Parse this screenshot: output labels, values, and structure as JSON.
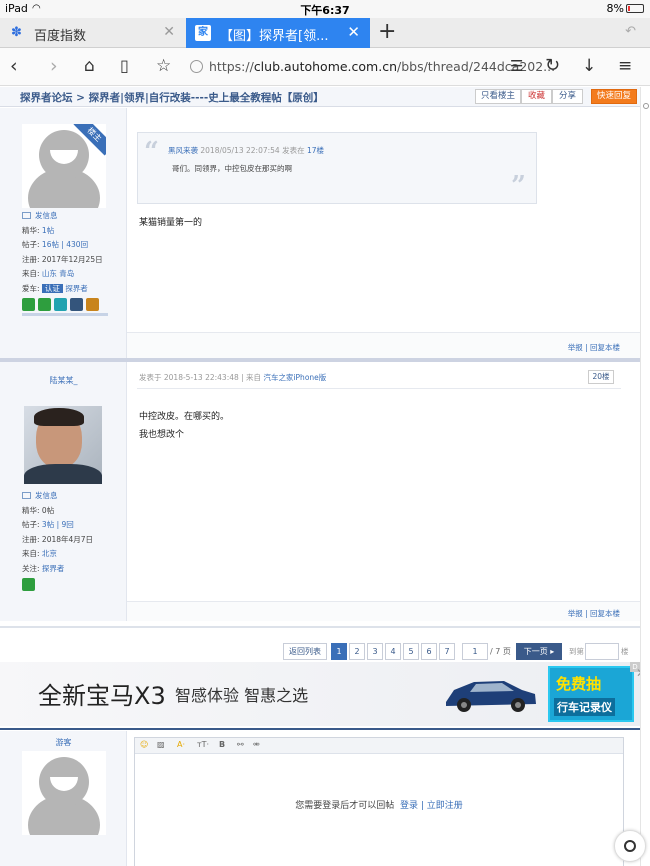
{
  "status": {
    "device": "iPad",
    "time": "下午6:37",
    "battery": "8%"
  },
  "tabs": [
    {
      "title": "百度指数",
      "active": false
    },
    {
      "title": "【图】探界者[领...",
      "active": true
    }
  ],
  "toolbar": {
    "url_prefix": "https://",
    "url_host": "club.autohome.com.cn",
    "url_path": "/bbs/thread/244dca202..."
  },
  "breadcrumb": {
    "forum": "探界者论坛",
    "sep": " > ",
    "title": "探界者|领界|自行改装----史上最全教程帖【原创】"
  },
  "thread_buttons": {
    "only_author": "只看楼主",
    "favorite": "收藏",
    "share": "分享",
    "quick_reply": "快速回复"
  },
  "post1": {
    "badge": "楼主",
    "send_msg": "发信息",
    "jinghua_label": "精华:",
    "jinghua_value": "1帖",
    "tiezi_label": "帖子:",
    "tiezi_value": "16帖 | 430回",
    "reg_label": "注册:",
    "reg_value": "2017年12月25日",
    "from_label": "来自:",
    "from_value": "山东 青岛",
    "car_label": "爱车:",
    "car_tag": "认证",
    "car_value": "探界者",
    "quote_author": "黑风来袭",
    "quote_time": " 2018/05/13 22:07:54 发表在 ",
    "quote_floor": "17楼",
    "quote_text": "哥们。同领界，中控包皮在那买的啊",
    "content": "某猫销量第一的",
    "report": "举报",
    "reply_this": "回复本楼"
  },
  "post2": {
    "username": "陆某某_",
    "send_msg": "发信息",
    "jinghua_label": "精华:",
    "jinghua_value": "0帖",
    "tiezi_label": "帖子:",
    "tiezi_value": "3帖 | 9回",
    "reg_label": "注册:",
    "reg_value": "2018年4月7日",
    "from_label": "来自:",
    "from_value": "北京",
    "follow_label": "关注:",
    "follow_value": "探界者",
    "meta_prefix": "发表于 2018-5-13 22:43:48 | 来自 ",
    "meta_source": "汽车之家iPhone版",
    "floor": "20楼",
    "content_line1": "中控改皮。在哪买的。",
    "content_line2": "我也想改个",
    "report": "举报",
    "reply_this": "回复本楼"
  },
  "pager": {
    "back": "返回列表",
    "pages": [
      "1",
      "2",
      "3",
      "4",
      "5",
      "6",
      "7"
    ],
    "current": "1",
    "input_value": "1",
    "total": "/ 7 页",
    "next": "下一页",
    "goto": "到第",
    "unit": "楼"
  },
  "ad": {
    "headline": "全新宝马X3",
    "tagline": "智感体验 智惠之选",
    "promo_top": "免费抽",
    "promo_bottom": "行车记录仪",
    "corner": "D"
  },
  "reply": {
    "guest": "游客",
    "login_text": "您需要登录后才可以回帖",
    "login": "登录",
    "divider": " | ",
    "register": "立即注册"
  },
  "colors": {
    "accent": "#3a6fb8",
    "tab_active": "#2e84f0",
    "quick_reply": "#f37b1d"
  }
}
